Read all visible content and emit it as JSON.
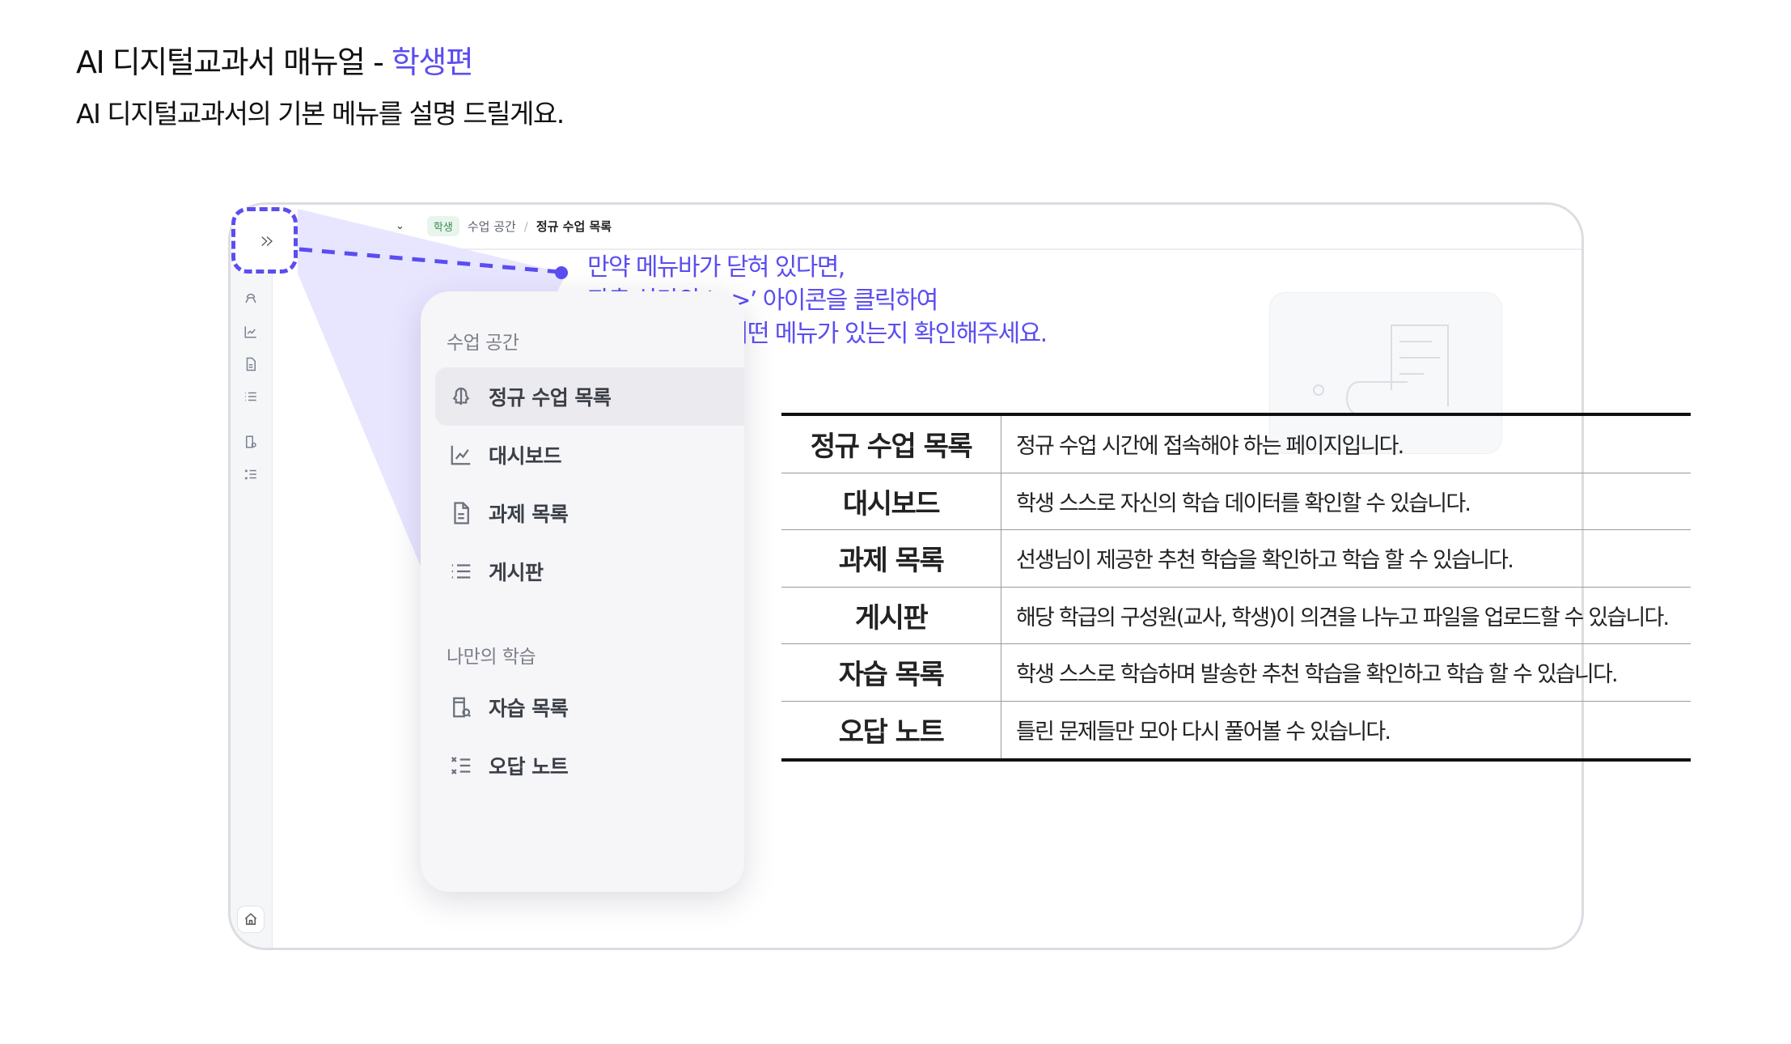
{
  "header": {
    "title_prefix": "AI 디지털교과서 매뉴얼 - ",
    "title_accent": "학생편",
    "subtitle": "AI 디지털교과서의 기본 메뉴를 설명 드릴게요."
  },
  "breadcrumb": {
    "badge": "학생",
    "parent": "수업 공간",
    "separator": "/",
    "current": "정규 수업 목록"
  },
  "toggle": {
    "glyph": "»"
  },
  "callout": {
    "lines": [
      "만약 메뉴바가 닫혀 있다면,",
      "좌측 상단의 ‘>>’ 아이콘을 클릭하여",
      "메뉴바를 열어 어떤 메뉴가 있는지 확인해주세요."
    ]
  },
  "menu": {
    "section1": "수업 공간",
    "section2": "나만의 학습",
    "items": [
      {
        "label": "정규 수업 목록",
        "icon": "brain-icon"
      },
      {
        "label": "대시보드",
        "icon": "chart-icon"
      },
      {
        "label": "과제 목록",
        "icon": "document-icon"
      },
      {
        "label": "게시판",
        "icon": "list-icon"
      },
      {
        "label": "자습 목록",
        "icon": "book-search-icon"
      },
      {
        "label": "오답 노트",
        "icon": "checklist-icon"
      }
    ]
  },
  "table": {
    "rows": [
      {
        "name": "정규 수업 목록",
        "desc": "정규 수업 시간에 접속해야 하는 페이지입니다."
      },
      {
        "name": "대시보드",
        "desc": "학생 스스로 자신의 학습 데이터를 확인할 수 있습니다."
      },
      {
        "name": "과제 목록",
        "desc": "선생님이 제공한 추천 학습을 확인하고 학습 할 수 있습니다."
      },
      {
        "name": "게시판",
        "desc": "해당 학급의 구성원(교사, 학생)이 의견을 나누고 파일을 업로드할 수 있습니다."
      },
      {
        "name": "자습 목록",
        "desc": "학생 스스로 학습하며 발송한 추천 학습을 확인하고 학습 할 수 있습니다."
      },
      {
        "name": "오답 노트",
        "desc": "틀린 문제들만 모아 다시 풀어볼 수 있습니다."
      }
    ]
  },
  "colors": {
    "accent": "#5b4df0",
    "highlight": "#e6e3ff"
  }
}
